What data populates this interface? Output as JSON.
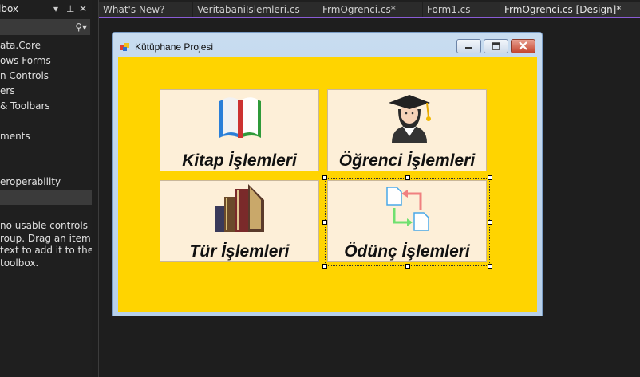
{
  "toolbox": {
    "title": "lbox",
    "search_text": "",
    "items": [
      {
        "label": "ata.Core"
      },
      {
        "label": "ows Forms"
      },
      {
        "label": "n Controls"
      },
      {
        "label": "ers"
      },
      {
        "label": "& Toolbars"
      },
      {
        "label": ""
      },
      {
        "label": "ments"
      },
      {
        "label": ""
      },
      {
        "label": ""
      },
      {
        "label": "eroperability"
      },
      {
        "label": ""
      }
    ],
    "empty_message": [
      " no usable controls",
      "roup. Drag an item",
      "text to add it to the",
      " toolbox."
    ]
  },
  "tabs": [
    {
      "label": "What's New?"
    },
    {
      "label": "VeritabaniIslemleri.cs"
    },
    {
      "label": "FrmOgrenci.cs*"
    },
    {
      "label": "Form1.cs"
    },
    {
      "label": "FrmOgrenci.cs [Design]*"
    }
  ],
  "form": {
    "title": "Kütüphane Projesi",
    "client_color": "#ffd400",
    "tiles": [
      {
        "label": "Kitap İşlemleri",
        "icon": "book-icon"
      },
      {
        "label": "Öğrenci İşlemleri",
        "icon": "student-icon"
      },
      {
        "label": "Tür İşlemleri",
        "icon": "books-stack-icon"
      },
      {
        "label": "Ödünç İşlemleri",
        "icon": "file-exchange-icon"
      }
    ]
  }
}
